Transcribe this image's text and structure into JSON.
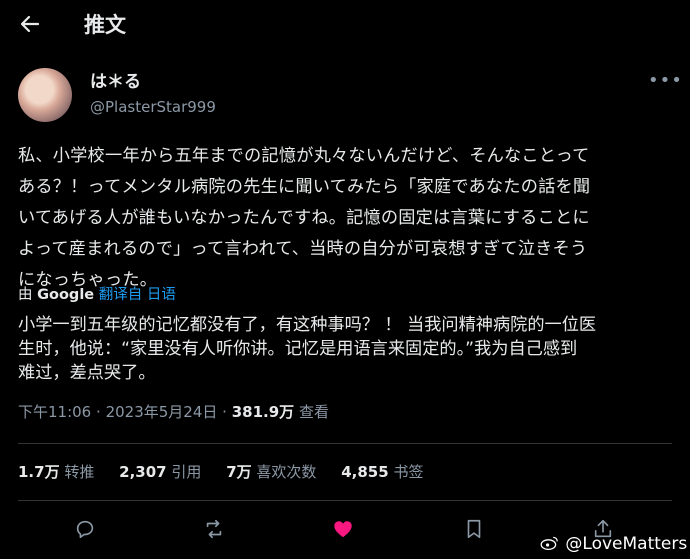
{
  "header": {
    "back_icon": "arrow-left-icon",
    "title": "推文"
  },
  "author": {
    "name": "は＊る",
    "handle": "@PlasterStar999"
  },
  "tweet": {
    "text_lines": [
      "私、小学校一年から五年までの記憶が丸々ないんだけど、そんなことって",
      "ある？！ってメンタル病院の先生に聞いてみたら「家庭であなたの話を聞",
      "いてあげる人が誰もいなかったんですね。記憶の固定は言葉にすることに",
      "よって産まれるので」って言われて、当時の自分が可哀想すぎて泣きそう",
      "になっちゃった。"
    ],
    "translated_by": "由",
    "translator": "Google",
    "translate_link": "翻译自 日语",
    "translation_lines": [
      "小学一到五年级的记忆都没有了，有这种事吗？ ！ 当我问精神病院的一位医",
      "生时，他说：“家里没有人听你讲。记忆是用语言来固定的。”我为自己感到",
      "难过，差点哭了。"
    ]
  },
  "meta": {
    "time": "下午11:06",
    "date": "2023年5月24日",
    "dot": "·",
    "views": "381.9万",
    "views_label": "查看"
  },
  "stats": [
    {
      "count": "1.7万",
      "label": "转推"
    },
    {
      "count": "2,307",
      "label": "引用"
    },
    {
      "count": "7万",
      "label": "喜欢次数"
    },
    {
      "count": "4,855",
      "label": "书签"
    }
  ],
  "colors": {
    "background": "#000000",
    "text": "#e7e9ea",
    "secondary": "#8b98a5",
    "link": "#1d9bf0",
    "like": "#f91880"
  },
  "watermark": "@LoveMatters"
}
